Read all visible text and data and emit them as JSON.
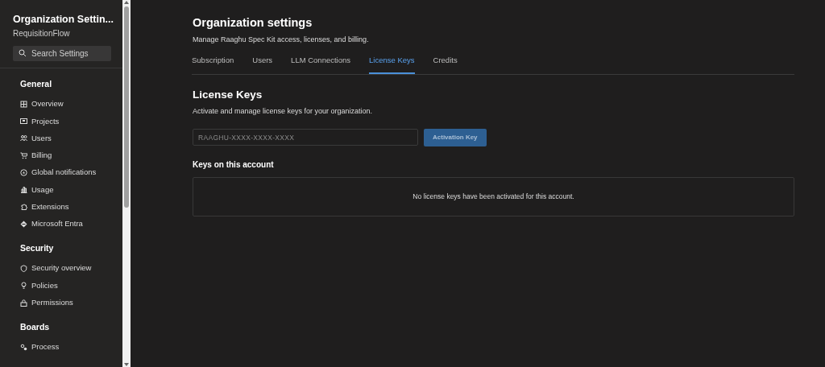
{
  "sidebar": {
    "title": "Organization Settin...",
    "subtitle": "RequisitionFlow",
    "search": {
      "placeholder": "Search Settings"
    },
    "sections": [
      {
        "heading": "General",
        "items": [
          {
            "label": "Overview"
          },
          {
            "label": "Projects"
          },
          {
            "label": "Users"
          },
          {
            "label": "Billing"
          },
          {
            "label": "Global notifications"
          },
          {
            "label": "Usage"
          },
          {
            "label": "Extensions"
          },
          {
            "label": "Microsoft Entra"
          }
        ]
      },
      {
        "heading": "Security",
        "items": [
          {
            "label": "Security overview"
          },
          {
            "label": "Policies"
          },
          {
            "label": "Permissions"
          }
        ]
      },
      {
        "heading": "Boards",
        "items": [
          {
            "label": "Process"
          }
        ]
      }
    ]
  },
  "header": {
    "title": "Organization settings",
    "subtitle": "Manage Raaghu Spec Kit access, licenses, and billing."
  },
  "tabs": [
    {
      "label": "Subscription",
      "selected": false
    },
    {
      "label": "Users",
      "selected": false
    },
    {
      "label": "LLM Connections",
      "selected": false
    },
    {
      "label": "License Keys",
      "selected": true
    },
    {
      "label": "Credits",
      "selected": false
    }
  ],
  "panel": {
    "title": "License Keys",
    "description": "Activate and manage license keys for your organization.",
    "key_field": {
      "placeholder": "RAAGHU-XXXX-XXXX-XXXX"
    },
    "activate_button": {
      "label": "Activation Key",
      "disabled": true
    },
    "keys_heading": "Keys on this account",
    "empty_message": "No license keys have been activated for this account."
  }
}
